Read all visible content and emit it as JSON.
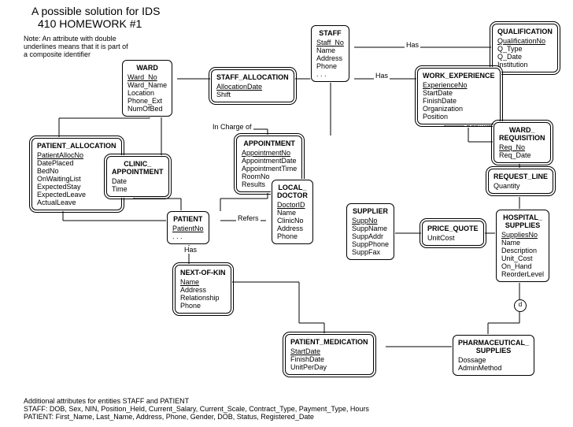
{
  "header": {
    "title": "A possible solution for IDS",
    "subtitle": "410 HOMEWORK #1"
  },
  "note": "Note:\nAn attribute with double underlines  means that it is part of a composite identifier",
  "rel_labels": {
    "has1": "Has",
    "in_charge": "In Charge of",
    "has2": "Has",
    "refers": "Refers",
    "has3": "Has",
    "submits": "Submits"
  },
  "entities": {
    "ward": {
      "name": "WARD",
      "attrs": [
        {
          "t": "Ward_No",
          "k": 1
        },
        {
          "t": "Ward_Name"
        },
        {
          "t": "Location"
        },
        {
          "t": "Phone_Ext"
        },
        {
          "t": "NumOfBed"
        }
      ]
    },
    "staff": {
      "name": "STAFF",
      "attrs": [
        {
          "t": "Staff_No",
          "k": 1
        },
        {
          "t": "Name"
        },
        {
          "t": "Address"
        },
        {
          "t": "Phone"
        },
        {
          "t": ". . ."
        }
      ]
    },
    "qualification": {
      "name": "QUALIFICATION",
      "attrs": [
        {
          "t": "QualificationNo",
          "k": 1
        },
        {
          "t": "Q_Type"
        },
        {
          "t": "Q_Date"
        },
        {
          "t": "Institution"
        }
      ]
    },
    "work_experience": {
      "name": "WORK_EXPERIENCE",
      "attrs": [
        {
          "t": "ExperienceNo",
          "k": 1
        },
        {
          "t": "StartDate"
        },
        {
          "t": "FinishDate"
        },
        {
          "t": "Organization"
        },
        {
          "t": "Position"
        }
      ]
    },
    "staff_allocation": {
      "name": "STAFF_ALLOCATION",
      "attrs": [
        {
          "t": "AllocationDate",
          "k": 1
        },
        {
          "t": "Shift"
        }
      ]
    },
    "patient_allocation": {
      "name": "PATIENT_ALLOCATION",
      "attrs": [
        {
          "t": "PatientAllocNo",
          "k": 1
        },
        {
          "t": "DatePlaced"
        },
        {
          "t": "BedNo"
        },
        {
          "t": "OnWaitingList"
        },
        {
          "t": "ExpectedStay"
        },
        {
          "t": "ExpectedLeave"
        },
        {
          "t": "ActualLeave"
        }
      ]
    },
    "clinic_appointment": {
      "name": "CLINIC_\nAPPOINTMENT",
      "attrs": [
        {
          "t": "Date"
        },
        {
          "t": "Time"
        }
      ]
    },
    "appointment": {
      "name": "APPOINTMENT",
      "attrs": [
        {
          "t": "AppointmentNo",
          "k": 1
        },
        {
          "t": "AppointmentDate"
        },
        {
          "t": "AppointmentTime"
        },
        {
          "t": "RoomNo"
        },
        {
          "t": "Results"
        }
      ]
    },
    "patient": {
      "name": "PATIENT",
      "attrs": [
        {
          "t": "PatientNo",
          "k": 1
        },
        {
          "t": ". . ."
        }
      ]
    },
    "local_doctor": {
      "name": "LOCAL_\nDOCTOR",
      "attrs": [
        {
          "t": "DoctorID",
          "k": 1
        },
        {
          "t": "Name"
        },
        {
          "t": "ClinicNo"
        },
        {
          "t": "Address"
        },
        {
          "t": "Phone"
        }
      ]
    },
    "next_of_kin": {
      "name": "NEXT-OF-KIN",
      "attrs": [
        {
          "t": "Name",
          "k": 1
        },
        {
          "t": "Address"
        },
        {
          "t": "Relationship"
        },
        {
          "t": "Phone"
        }
      ]
    },
    "patient_medication": {
      "name": "PATIENT_MEDICATION",
      "attrs": [
        {
          "t": "StartDate",
          "k": 1
        },
        {
          "t": "FinishDate"
        },
        {
          "t": "UnitPerDay"
        }
      ]
    },
    "supplier": {
      "name": "SUPPLIER",
      "attrs": [
        {
          "t": "SuppNo",
          "k": 1
        },
        {
          "t": "SuppName"
        },
        {
          "t": "SuppAddr"
        },
        {
          "t": "SuppPhone"
        },
        {
          "t": "SuppFax"
        }
      ]
    },
    "price_quote": {
      "name": "PRICE_QUOTE",
      "attrs": [
        {
          "t": "UnitCost"
        }
      ]
    },
    "hospital_supplies": {
      "name": "HOSPITAL_\nSUPPLIES",
      "attrs": [
        {
          "t": "SuppliesNo",
          "k": 1
        },
        {
          "t": "Name"
        },
        {
          "t": "Description"
        },
        {
          "t": "Unit_Cost"
        },
        {
          "t": "On_Hand"
        },
        {
          "t": "ReorderLevel"
        }
      ]
    },
    "pharmaceutical_supplies": {
      "name": "PHARMACEUTICAL_\nSUPPLIES",
      "attrs": [
        {
          "t": "Dossage"
        },
        {
          "t": "AdminMethod"
        }
      ]
    },
    "ward_requisition": {
      "name": "WARD_\nREQUISITION",
      "attrs": [
        {
          "t": "Req_No",
          "k": 1
        },
        {
          "t": "Req_Date"
        }
      ]
    },
    "request_line": {
      "name": "REQUEST_LINE",
      "attrs": [
        {
          "t": "Quantity"
        }
      ]
    }
  },
  "disj": "d",
  "footer": {
    "line1": "Additional attributes for entities STAFF and PATIENT",
    "line2": "STAFF: DOB, Sex, NIN, Position_Held, Current_Salary, Current_Scale, Contract_Type, Payment_Type, Hours",
    "line3": "PATIENT: First_Name, Last_Name, Address, Phone, Gender, DOB, Status, Registered_Date"
  }
}
